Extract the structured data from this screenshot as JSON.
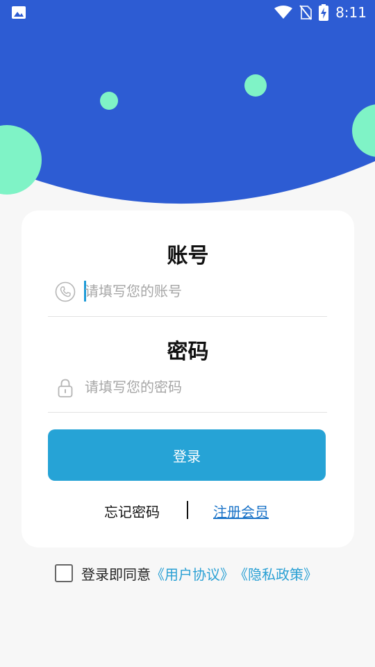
{
  "status_bar": {
    "time": "8:11",
    "icons": [
      "gallery-icon",
      "wifi-icon",
      "no-sim-icon",
      "battery-charging-icon"
    ]
  },
  "colors": {
    "hero_blue": "#2d5cd3",
    "bubble_green": "#7ff3c6",
    "button_blue": "#26a3d6",
    "link_blue": "#1a73c8",
    "agreement_blue": "#2aa0d4"
  },
  "login_form": {
    "account_title": "账号",
    "account_placeholder": "请填写您的账号",
    "account_icon": "phone-icon",
    "password_title": "密码",
    "password_placeholder": "请填写您的密码",
    "password_icon": "lock-icon",
    "login_button": "登录",
    "forgot_password": "忘记密码",
    "register": "注册会员"
  },
  "agreement": {
    "prefix": "登录即同意",
    "user_agreement": "《用户协议》",
    "privacy_policy": "《隐私政策》",
    "checked": false
  }
}
